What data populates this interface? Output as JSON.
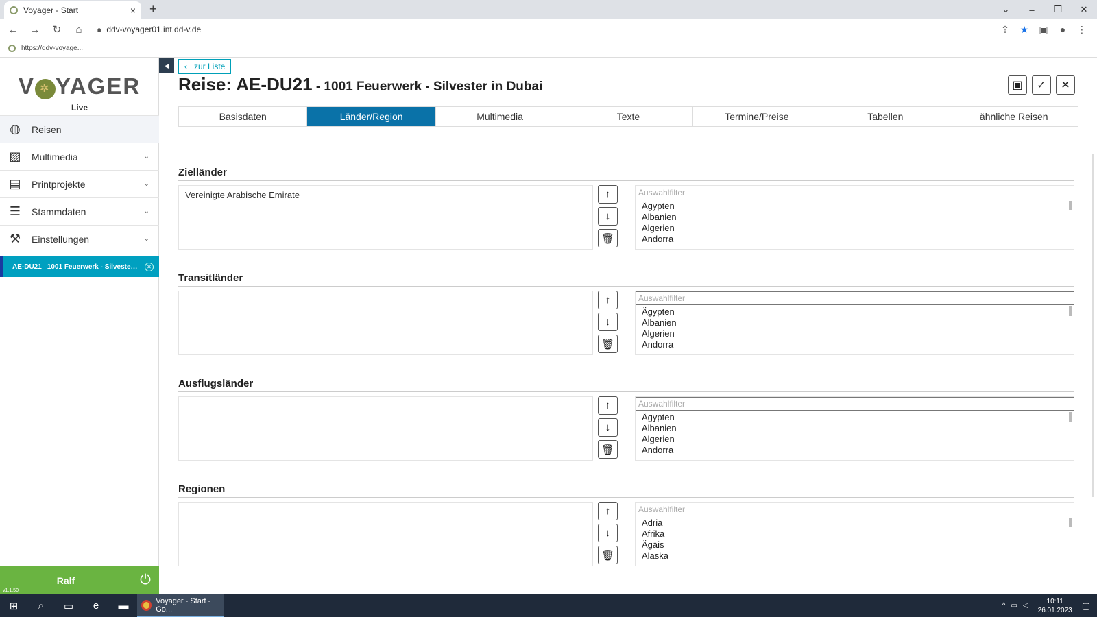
{
  "browser": {
    "tab_title": "Voyager - Start",
    "tab_close": "×",
    "new_tab": "+",
    "url": "ddv-voyager01.int.dd-v.de",
    "bookmark": "https://ddv-voyage..."
  },
  "sidebar": {
    "logo_left": "V",
    "logo_right": "YAGER",
    "env": "Live",
    "items": [
      {
        "label": "Reisen",
        "icon": "globe-icon"
      },
      {
        "label": "Multimedia",
        "icon": "images-icon"
      },
      {
        "label": "Printprojekte",
        "icon": "book-icon"
      },
      {
        "label": "Stammdaten",
        "icon": "list-icon"
      },
      {
        "label": "Einstellungen",
        "icon": "tools-icon"
      }
    ],
    "open_trip": {
      "code": "AE-DU21",
      "title": "1001 Feuerwerk - Silvester i..."
    },
    "user": "Ralf",
    "version": "v1.1.50"
  },
  "header": {
    "back_label": "zur Liste",
    "title": "Reise: AE-DU21",
    "subtitle": " - 1001 Feuerwerk - Silvester in Dubai"
  },
  "tabs": [
    "Basisdaten",
    "Länder/Region",
    "Multimedia",
    "Texte",
    "Termine/Preise",
    "Tabellen",
    "ähnliche Reisen"
  ],
  "active_tab": "Länder/Region",
  "sections": [
    {
      "title": "Zielländer",
      "selected": "Vereinigte Arabische Emirate",
      "filter_placeholder": "Auswahlfilter",
      "options": [
        "Ägypten",
        "Albanien",
        "Algerien",
        "Andorra"
      ]
    },
    {
      "title": "Transitländer",
      "selected": "",
      "filter_placeholder": "Auswahlfilter",
      "options": [
        "Ägypten",
        "Albanien",
        "Algerien",
        "Andorra"
      ]
    },
    {
      "title": "Ausflugsländer",
      "selected": "",
      "filter_placeholder": "Auswahlfilter",
      "options": [
        "Ägypten",
        "Albanien",
        "Algerien",
        "Andorra"
      ]
    },
    {
      "title": "Regionen",
      "selected": "",
      "filter_placeholder": "Auswahlfilter",
      "options": [
        "Adria",
        "Afrika",
        "Ägäis",
        "Alaska"
      ]
    }
  ],
  "taskbar": {
    "app_label": "Voyager - Start - Go...",
    "time": "10:11",
    "date": "26.01.2023"
  },
  "colors": {
    "accent": "#0a72a8",
    "sidebar_active": "#00a0c0",
    "user_bar": "#6ab441"
  }
}
